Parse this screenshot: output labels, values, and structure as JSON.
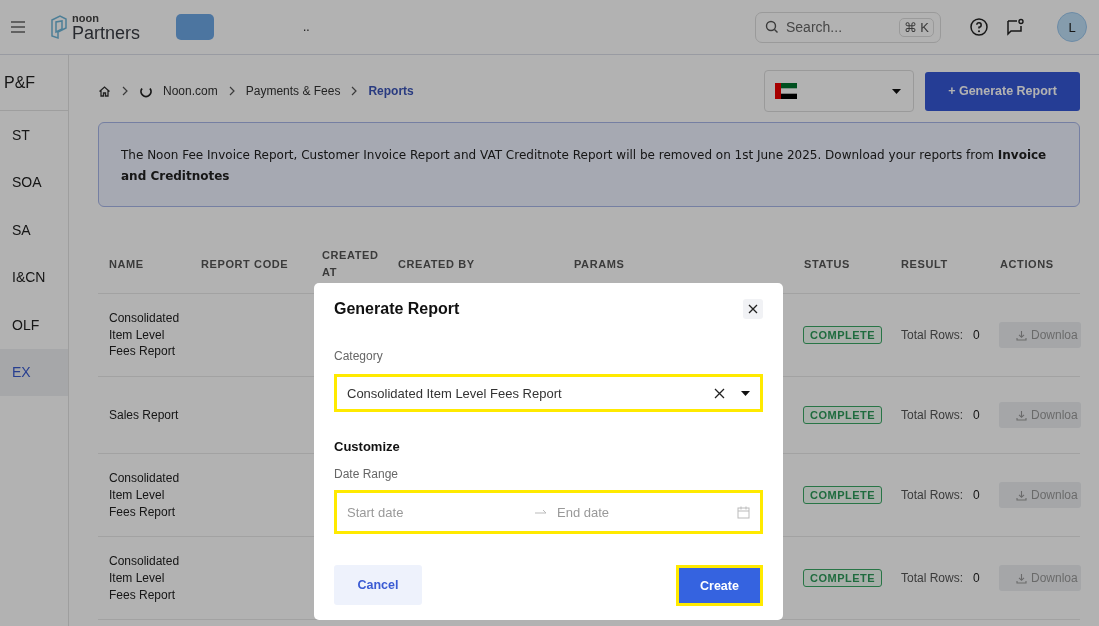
{
  "topbar": {
    "logo_small": "noon",
    "logo_text": "Partners",
    "account": "..",
    "search": {
      "placeholder": "Search...",
      "shortcut_symbol": "⌘",
      "shortcut_key": "K"
    },
    "avatar": "L"
  },
  "sidebar": {
    "title": "P&F",
    "items": [
      {
        "label": "ST",
        "selected": false
      },
      {
        "label": "SOA",
        "selected": false
      },
      {
        "label": "SA",
        "selected": false
      },
      {
        "label": "I&CN",
        "selected": false
      },
      {
        "label": "OLF",
        "selected": false
      },
      {
        "label": "EX",
        "selected": true
      }
    ]
  },
  "breadcrumb": [
    {
      "label": "Noon.com",
      "current": false
    },
    {
      "label": "Payments & Fees",
      "current": false
    },
    {
      "label": "Reports",
      "current": true
    }
  ],
  "generate_button": "+ Generate Report",
  "banner": "The Noon Fee Invoice Report, Customer Invoice Report and VAT Creditnote Report will be removed on 1st June 2025. Download your reports from **Invoice and Creditnotes**",
  "table": {
    "columns": [
      "NAME",
      "REPORT CODE",
      "CREATED AT",
      "CREATED BY",
      "PARAMS",
      "STATUS",
      "RESULT",
      "ACTIONS"
    ],
    "rows": [
      {
        "name": "Consolidated Item Level Fees Report",
        "status": "COMPLETE",
        "result_label": "Total Rows:",
        "result_value": "0",
        "action": "Downloa"
      },
      {
        "name": "Sales Report",
        "status": "COMPLETE",
        "result_label": "Total Rows:",
        "result_value": "0",
        "action": "Downloa"
      },
      {
        "name": "Consolidated Item Level Fees Report",
        "status": "COMPLETE",
        "result_label": "Total Rows:",
        "result_value": "0",
        "action": "Downloa"
      },
      {
        "name": "Consolidated Item Level Fees Report",
        "status": "COMPLETE",
        "result_label": "Total Rows:",
        "result_value": "0",
        "action": "Downloa"
      }
    ]
  },
  "dialog": {
    "title": "Generate Report",
    "category_label": "Category",
    "category": {
      "value": "Consolidated Item Level Fees Report",
      "highlighted": true
    },
    "section": "Customize",
    "date_label": "Date Range",
    "date_range": {
      "start_placeholder": "Start date",
      "end_placeholder": "End date",
      "highlighted": true
    },
    "cancel": "Cancel",
    "create": {
      "label": "Create",
      "highlighted": true
    }
  }
}
